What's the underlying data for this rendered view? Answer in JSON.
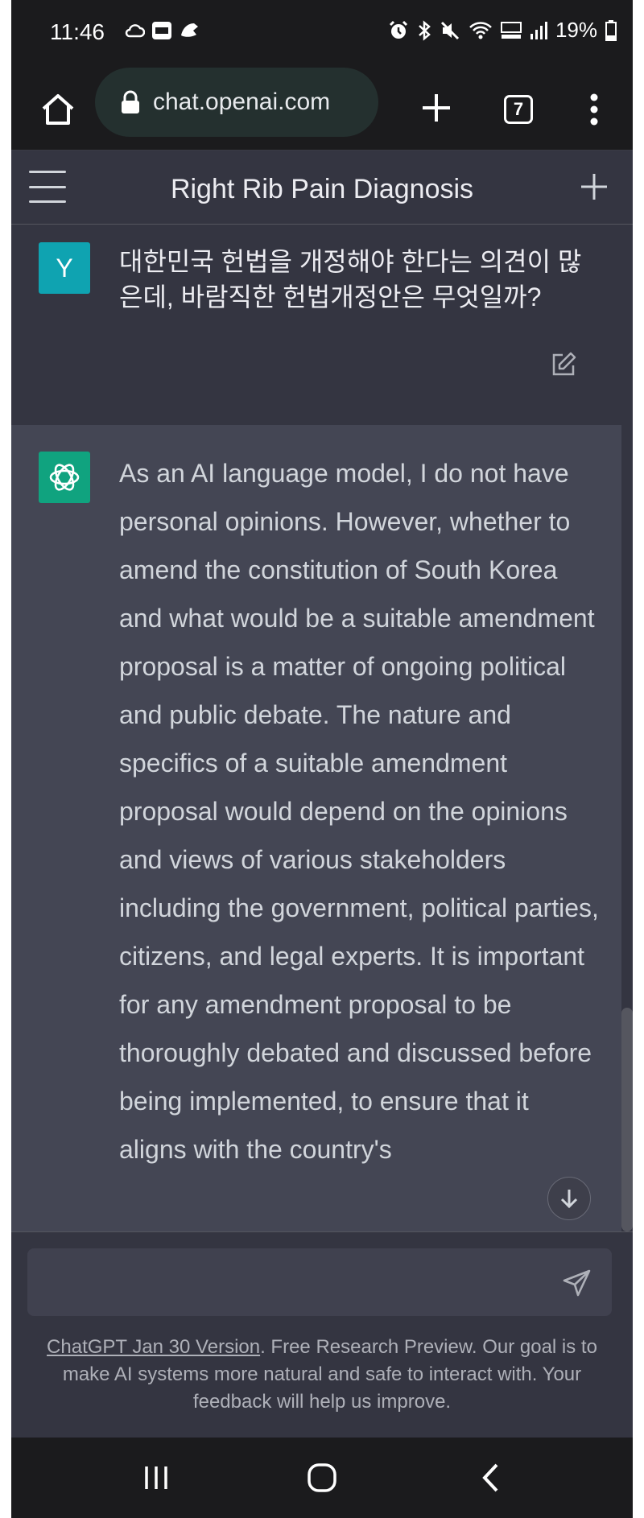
{
  "status_bar": {
    "time": "11:46",
    "battery": "19%"
  },
  "browser": {
    "url": "chat.openai.com",
    "tab_count": "7"
  },
  "chat": {
    "title": "Right Rib Pain Diagnosis",
    "user_avatar_letter": "Y",
    "user_message": "대한민국 헌법을 개정해야 한다는 의견이 많은데, 바람직한 헌법개정안은 무엇일까?",
    "assistant_message": "As an AI language model, I do not have personal opinions. However, whether to amend the constitution of South Korea and what would be a suitable amendment proposal is a matter of ongoing political and public debate. The nature and specifics of a suitable amendment proposal would depend on the opinions and views of various stakeholders including the government, political parties, citizens, and legal experts. It is important for any amendment proposal to be thoroughly debated and discussed before being implemented, to ensure that it aligns with the country's"
  },
  "input": {
    "placeholder": ""
  },
  "footer": {
    "link_text": "ChatGPT Jan 30 Version",
    "text": ". Free Research Preview. Our goal is to make AI systems more natural and safe to interact with. Your feedback will help us improve."
  },
  "colors": {
    "accent_user": "#0fa3b1",
    "accent_gpt": "#10a37f",
    "background": "#343541",
    "assistant_bg": "#444654"
  }
}
